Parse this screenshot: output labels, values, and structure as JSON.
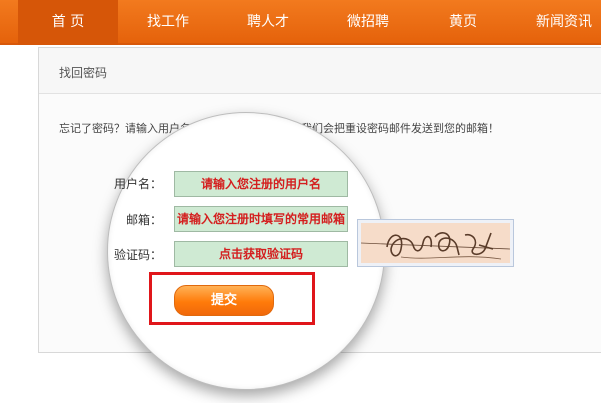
{
  "nav": {
    "items": [
      {
        "label": "首 页",
        "active": true
      },
      {
        "label": "找工作"
      },
      {
        "label": "聘人才"
      },
      {
        "label": "微招聘"
      },
      {
        "label": "黄页"
      },
      {
        "label": "新闻资讯"
      }
    ]
  },
  "panel": {
    "title": "找回密码",
    "instructions": "忘记了密码？请输入用户名和注册时填写的邮箱，我们会把重设密码邮件发送到您的邮箱！"
  },
  "form": {
    "username_label": "用户名：",
    "username_value": "请输入您注册的用户名",
    "email_label": "邮箱：",
    "email_value": "请输入您注册时填写的常用邮箱",
    "captcha_label": "验证码：",
    "captcha_value": "点击获取验证码",
    "submit_label": "提交"
  },
  "colors": {
    "nav_bg": "#ee6f16",
    "field_bg": "#cfead3",
    "field_text": "#d41f1f",
    "highlight": "#e0161a",
    "button": "#ff7b0a"
  }
}
